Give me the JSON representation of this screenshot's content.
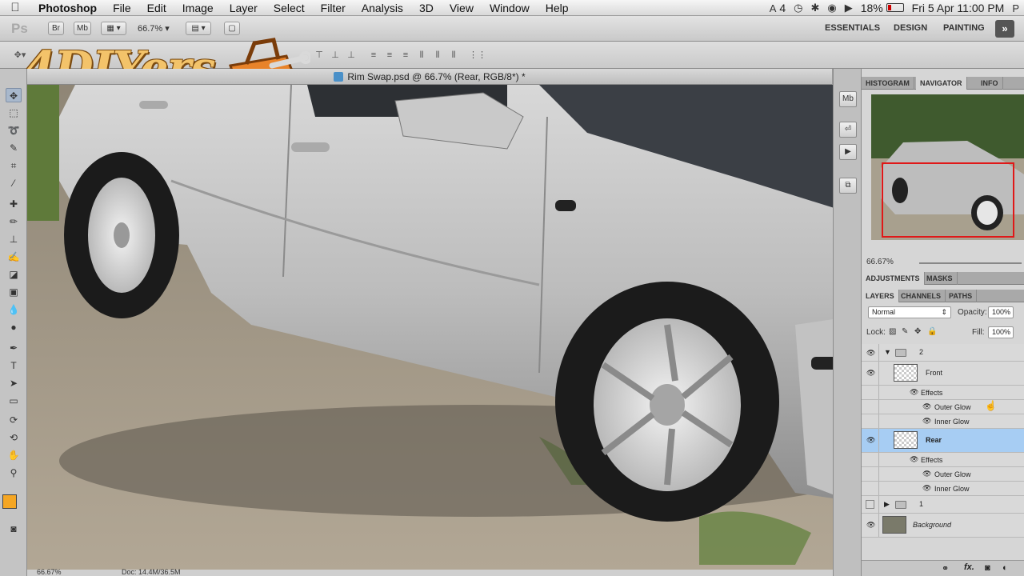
{
  "menubar": {
    "items": [
      "Photoshop",
      "File",
      "Edit",
      "Image",
      "Layer",
      "Select",
      "Filter",
      "Analysis",
      "3D",
      "View",
      "Window",
      "Help"
    ],
    "status_adobe": "4",
    "battery": "18%",
    "datetime": "Fri 5 Apr  11:00 PM"
  },
  "appbar": {
    "ps_label": "Ps",
    "br_label": "Br",
    "mb_label": "Mb",
    "zoom": "66.7%",
    "workspaces": [
      "ESSENTIALS",
      "DESIGN",
      "PAINTING"
    ],
    "more": "»"
  },
  "logo": {
    "text": "4DIYers"
  },
  "document": {
    "title": "Rim Swap.psd @ 66.7% (Rear, RGB/8*) *"
  },
  "statusbar": {
    "zoom": "66.67%",
    "doc": "Doc: 14.4M/36.5M"
  },
  "dock": {
    "mb": "Mb"
  },
  "panels": {
    "top_tabs": [
      "HISTOGRAM",
      "NAVIGATOR",
      "INFO"
    ],
    "top_tab_selected": "NAVIGATOR",
    "nav_zoom": "66.67%",
    "mid_tabs": [
      "ADJUSTMENTS",
      "MASKS"
    ],
    "layer_tabs": [
      "LAYERS",
      "CHANNELS",
      "PATHS"
    ],
    "blend_mode": "Normal",
    "opacity_label": "Opacity:",
    "opacity": "100%",
    "lock_label": "Lock:",
    "fill_label": "Fill:",
    "fill": "100%"
  },
  "layers": [
    {
      "name": "2",
      "kind": "group-open"
    },
    {
      "name": "Front",
      "kind": "layer"
    },
    {
      "name": "Effects",
      "kind": "effects"
    },
    {
      "name": "Outer Glow",
      "kind": "effect"
    },
    {
      "name": "Inner Glow",
      "kind": "effect"
    },
    {
      "name": "Rear",
      "kind": "layer-selected"
    },
    {
      "name": "Effects",
      "kind": "effects"
    },
    {
      "name": "Outer Glow",
      "kind": "effect"
    },
    {
      "name": "Inner Glow",
      "kind": "effect"
    },
    {
      "name": "1",
      "kind": "group-closed"
    },
    {
      "name": "Background",
      "kind": "background"
    }
  ],
  "colors": {
    "foreground": "#f5a623",
    "background": "#ffffff",
    "selection": "#a7cdf3"
  }
}
